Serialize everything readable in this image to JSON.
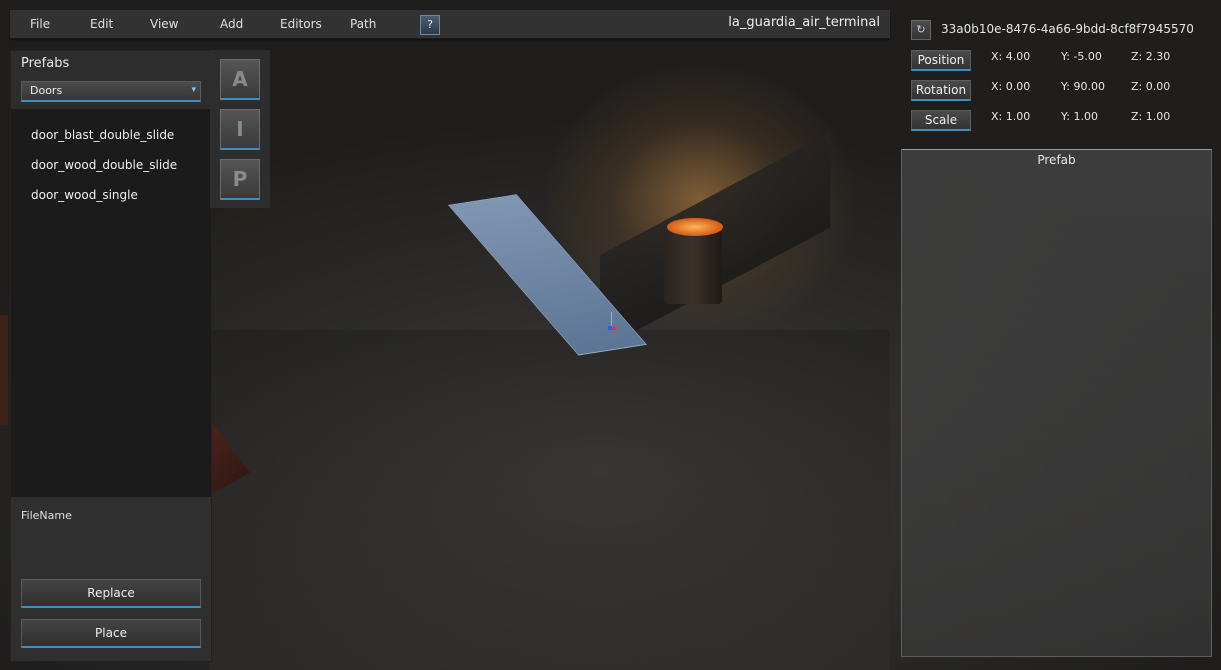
{
  "menu": {
    "items": [
      "File",
      "Edit",
      "View",
      "Add",
      "Editors",
      "Path"
    ],
    "help_label": "?",
    "scene_title": "la_guardia_air_terminal"
  },
  "left_panel": {
    "title": "Prefabs",
    "category_select": {
      "value": "Doors"
    },
    "prefab_items": [
      "door_blast_double_slide",
      "door_wood_double_slide",
      "door_wood_single"
    ],
    "filename_label": "FileName",
    "replace_label": "Replace",
    "place_label": "Place"
  },
  "tools": {
    "a_label": "A",
    "i_label": "I",
    "p_label": "P"
  },
  "inspector": {
    "guid": "33a0b10e-8476-4a66-9bdd-8cf8f7945570",
    "position": {
      "label": "Position",
      "x": "X: 4.00",
      "y": "Y: -5.00",
      "z": "Z: 2.30"
    },
    "rotation": {
      "label": "Rotation",
      "x": "X: 0.00",
      "y": "Y: 90.00",
      "z": "Z: 0.00"
    },
    "scale": {
      "label": "Scale",
      "x": "X: 1.00",
      "y": "Y: 1.00",
      "z": "Z: 1.00"
    },
    "prefab_section_title": "Prefab"
  },
  "colors": {
    "accent": "#3f8ec0",
    "panel": "#2d2d2d",
    "list_bg": "#1b1b1b"
  }
}
